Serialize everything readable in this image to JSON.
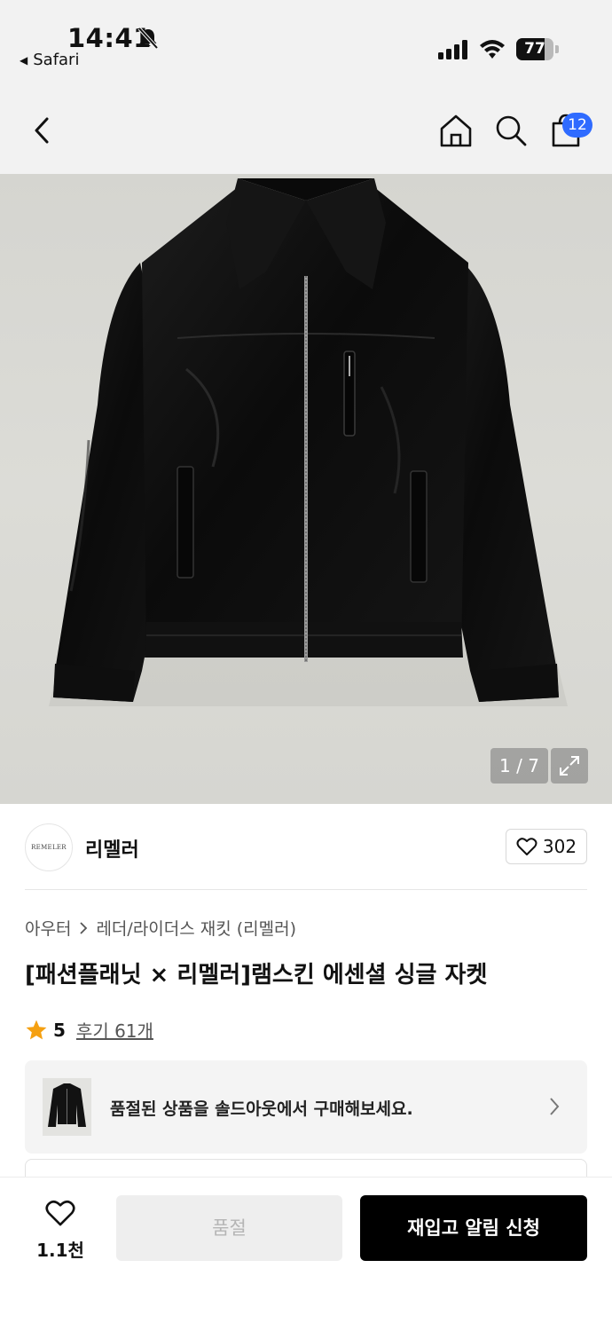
{
  "status_bar": {
    "time": "14:41",
    "back_app_label": "Safari",
    "battery_level": 77,
    "battery_text": "77"
  },
  "header": {
    "cart_count": "12",
    "icons": [
      "chevron-left-icon",
      "home-icon",
      "search-icon",
      "shopping-bag-icon"
    ]
  },
  "gallery": {
    "counter": "1 / 7"
  },
  "brand": {
    "logo_text": "REMELER",
    "name": "리멜러",
    "likes": "302"
  },
  "breadcrumb": {
    "category": "아우터",
    "subcategory": "레더/라이더스 재킷 (리멜러)"
  },
  "product": {
    "title": "[패션플래닛 × 리멜러]램스킨 에센셜 싱글 자켓",
    "rating": "5",
    "reviews": "후기 61개",
    "star_color": "#f5a011"
  },
  "soldout_banner": {
    "text": "품절된 상품을 솔드아웃에서 구매해보세요."
  },
  "bottom_bar": {
    "wish_count": "1.1천",
    "soldout_label": "품절",
    "restock_label": "재입고 알림 신청"
  },
  "colors": {
    "badge": "#2f6bff",
    "primary_button": "#000000",
    "disabled_button": "#eeeeee"
  }
}
